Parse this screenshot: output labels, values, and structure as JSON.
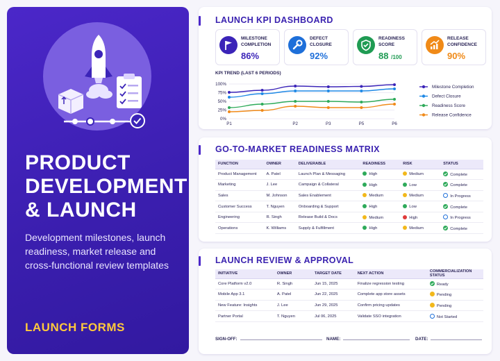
{
  "hero": {
    "title_lines": [
      "PRODUCT",
      "DEVELOPMENT",
      "& LAUNCH"
    ],
    "subtitle": "Development milestones, launch readiness, market release and cross-functional review templates",
    "tag": "LAUNCH FORMS",
    "illustration_icons": [
      "rocket-icon",
      "package-icon",
      "checklist-icon",
      "timeline-icon",
      "check-circle-icon"
    ]
  },
  "kpi_dashboard": {
    "title": "LAUNCH KPI DASHBOARD",
    "kpis": [
      {
        "label": "MILESTONE COMPLETION",
        "value": "86%",
        "suffix": "",
        "icon": "flag-icon",
        "color": "#3b24b8"
      },
      {
        "label": "DEFECT CLOSURE",
        "value": "92%",
        "suffix": "",
        "icon": "wrench-icon",
        "color": "#1e6fd9"
      },
      {
        "label": "READINESS SCORE",
        "value": "88",
        "suffix": "/100",
        "icon": "shield-check-icon",
        "color": "#1f9b53"
      },
      {
        "label": "RELEASE CONFIDENCE",
        "value": "90%",
        "suffix": "",
        "icon": "trend-up-icon",
        "color": "#f08a18"
      }
    ],
    "trend_title": "KPI TREND (LAST 6 PERIODS)"
  },
  "chart_data": {
    "type": "line",
    "title": "KPI TREND (LAST 6 PERIODS)",
    "x": [
      "P1",
      "",
      "P2",
      "P3",
      "P5",
      "P6"
    ],
    "x_tick_labels": [
      "P1",
      "P2",
      "P3",
      "P5",
      "P6"
    ],
    "ylim": [
      0,
      100
    ],
    "y_ticks": [
      "100%",
      "75%",
      "50%",
      "25%",
      "0%"
    ],
    "grid": true,
    "legend_position": "right",
    "series": [
      {
        "name": "Milestone Completion",
        "color": "#3b24b8",
        "values": [
          76,
          82,
          94,
          92,
          93,
          98
        ]
      },
      {
        "name": "Defect Closure",
        "color": "#1e88e5",
        "values": [
          62,
          72,
          80,
          80,
          80,
          86
        ]
      },
      {
        "name": "Readiness Score",
        "color": "#2eaa5a",
        "values": [
          32,
          42,
          50,
          50,
          48,
          56
        ]
      },
      {
        "name": "Release Confidence",
        "color": "#f08a18",
        "values": [
          20,
          24,
          36,
          32,
          32,
          42
        ]
      }
    ]
  },
  "matrix": {
    "title": "GO-TO-MARKET READINESS MATRIX",
    "headers": [
      "FUNCTION",
      "OWNER",
      "DELIVERABLE",
      "READINESS",
      "RISK",
      "STATUS"
    ],
    "rows": [
      {
        "function": "Product Management",
        "owner": "A. Patel",
        "deliverable": "Launch Plan & Messaging",
        "readiness": "High",
        "readiness_color": "#2eaa5a",
        "risk": "Medium",
        "risk_color": "#f2b81b",
        "status": "Complete",
        "status_icon": "check-circle-icon",
        "status_color": "#2eaa5a"
      },
      {
        "function": "Marketing",
        "owner": "J. Lee",
        "deliverable": "Campaign & Collateral",
        "readiness": "High",
        "readiness_color": "#2eaa5a",
        "risk": "Low",
        "risk_color": "#2eaa5a",
        "status": "Complete",
        "status_icon": "check-circle-icon",
        "status_color": "#2eaa5a"
      },
      {
        "function": "Sales",
        "owner": "M. Johnson",
        "deliverable": "Sales Enablement",
        "readiness": "Medium",
        "readiness_color": "#f2b81b",
        "risk": "Medium",
        "risk_color": "#f2b81b",
        "status": "In Progress",
        "status_icon": "progress-circle-icon",
        "status_color": "#1e6fd9"
      },
      {
        "function": "Customer Success",
        "owner": "T. Nguyen",
        "deliverable": "Onboarding & Support",
        "readiness": "High",
        "readiness_color": "#2eaa5a",
        "risk": "Low",
        "risk_color": "#2eaa5a",
        "status": "Complete",
        "status_icon": "check-circle-icon",
        "status_color": "#2eaa5a"
      },
      {
        "function": "Engineering",
        "owner": "R. Singh",
        "deliverable": "Release Build & Docs",
        "readiness": "Medium",
        "readiness_color": "#f2b81b",
        "risk": "High",
        "risk_color": "#e03a3a",
        "status": "In Progress",
        "status_icon": "progress-circle-icon",
        "status_color": "#1e6fd9"
      },
      {
        "function": "Operations",
        "owner": "K. Williams",
        "deliverable": "Supply & Fulfillment",
        "readiness": "High",
        "readiness_color": "#2eaa5a",
        "risk": "Medium",
        "risk_color": "#f2b81b",
        "status": "Complete",
        "status_icon": "check-circle-icon",
        "status_color": "#2eaa5a"
      }
    ]
  },
  "review": {
    "title": "LAUNCH REVIEW & APPROVAL",
    "headers": [
      "INITIATIVE",
      "OWNER",
      "TARGET DATE",
      "NEXT ACTION",
      "COMMERCIALIZATION STATUS"
    ],
    "rows": [
      {
        "initiative": "Core Platform v2.0",
        "owner": "R. Singh",
        "date": "Jun 15, 2025",
        "action": "Finalize regression testing",
        "status": "Ready",
        "status_color": "#2eaa5a",
        "status_icon": "check-circle-icon"
      },
      {
        "initiative": "Mobile App 3.1",
        "owner": "A. Patel",
        "date": "Jun 22, 2025",
        "action": "Complete app store assets",
        "status": "Pending",
        "status_color": "#f2b81b",
        "status_icon": "pending-dot-icon"
      },
      {
        "initiative": "New Feature: Insights",
        "owner": "J. Lee",
        "date": "Jun 29, 2025",
        "action": "Confirm pricing updates",
        "status": "Pending",
        "status_color": "#f2b81b",
        "status_icon": "pending-dot-icon"
      },
      {
        "initiative": "Partner Portal",
        "owner": "T. Nguyen",
        "date": "Jul 06, 2025",
        "action": "Validate SSO integration",
        "status": "Not Started",
        "status_color": "#1e6fd9",
        "status_icon": "empty-circle-icon"
      }
    ],
    "signoff": {
      "sign_label": "SIGN-OFF:",
      "name_label": "NAME:",
      "date_label": "DATE:"
    }
  }
}
